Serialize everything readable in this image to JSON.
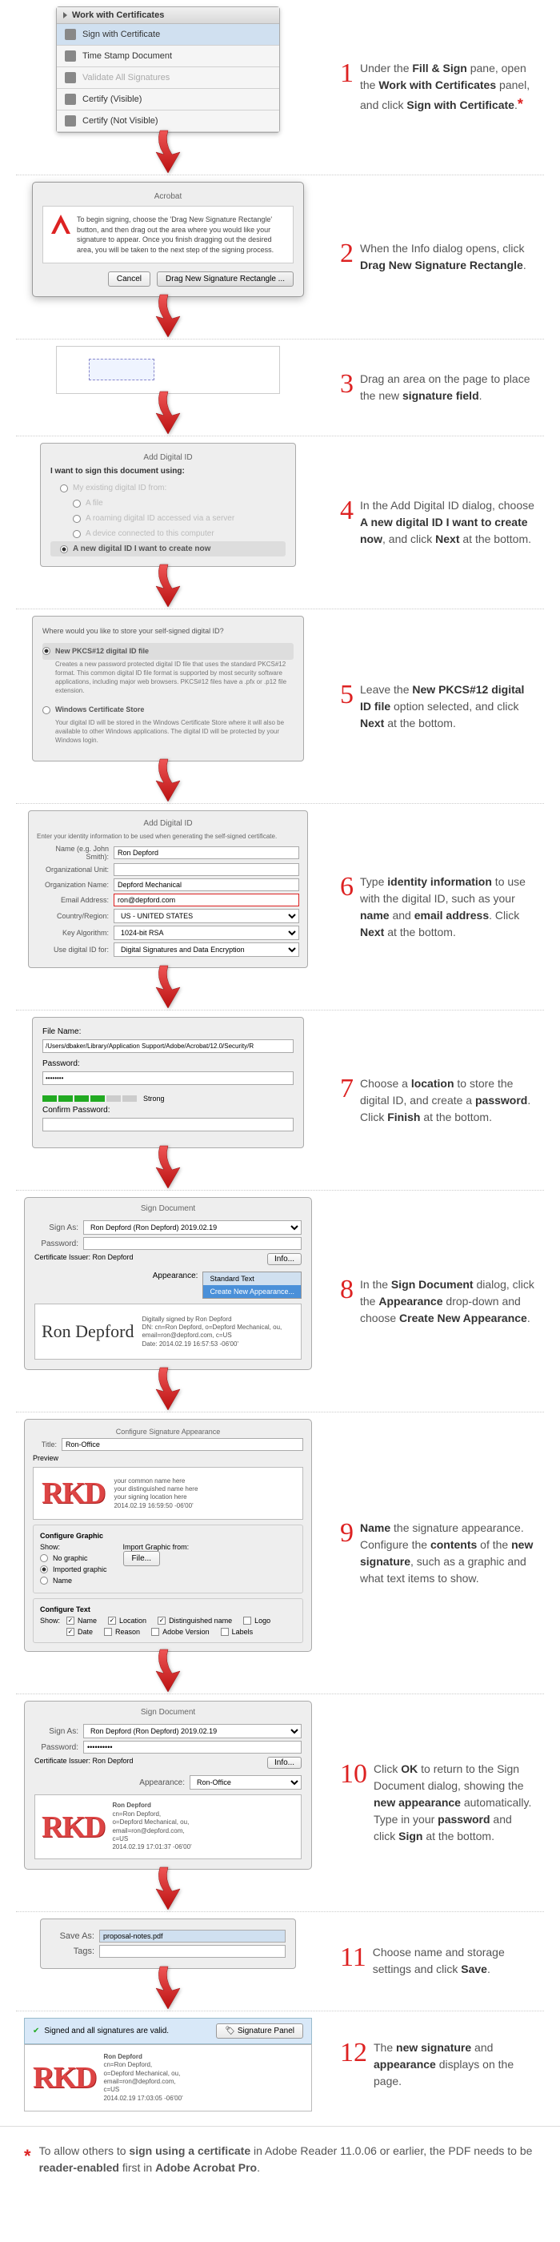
{
  "steps": {
    "s1": {
      "num": "1",
      "html": "Under the <b>Fill & Sign</b> pane, open the <b>Work with Certificates</b> panel, and click <b>Sign with Certificate</b>.<span class='asterisk'>*</span>"
    },
    "s2": {
      "num": "2",
      "html": "When the Info dialog opens, click <b>Drag New Signature Rectangle</b>."
    },
    "s3": {
      "num": "3",
      "html": "Drag an area on the page to place the new <b>signature field</b>."
    },
    "s4": {
      "num": "4",
      "html": "In the Add Digital ID dialog, choose <b>A new digital ID I want to create now</b>, and click <b>Next</b> at the bottom."
    },
    "s5": {
      "num": "5",
      "html": "Leave the <b>New PKCS#12 digital ID file</b> option selected, and click <b>Next</b> at the bottom."
    },
    "s6": {
      "num": "6",
      "html": "Type <b>identity information</b> to use with the digital ID, such as your <b>name</b> and <b>email address</b>. Click <b>Next</b> at the bottom."
    },
    "s7": {
      "num": "7",
      "html": "Choose a <b>location</b> to store the digital ID, and create a <b>password</b>. Click <b>Finish</b> at the bottom."
    },
    "s8": {
      "num": "8",
      "html": "In the <b>Sign Document</b> dialog, click the <b>Appearance</b> drop-down and choose <b>Create New Appearance</b>."
    },
    "s9": {
      "num": "9",
      "html": "<b>Name</b> the signature appearance. Configure the <b>contents</b> of the <b>new signature</b>, such as a graphic and what text items to show."
    },
    "s10": {
      "num": "10",
      "html": "Click <b>OK</b> to return to the Sign Document dialog, showing the <b>new appearance</b> automatically. Type in your <b>password</b> and click <b>Sign</b> at the bottom."
    },
    "s11": {
      "num": "11",
      "html": "Choose name and storage settings and click <b>Save</b>."
    },
    "s12": {
      "num": "12",
      "html": "The <b>new signature</b> and <b>appearance</b> displays on the page."
    }
  },
  "panel1": {
    "header": "Work with Certificates",
    "items": [
      "Sign with Certificate",
      "Time Stamp Document",
      "Validate All Signatures",
      "Certify (Visible)",
      "Certify (Not Visible)"
    ]
  },
  "dialog2": {
    "title": "Acrobat",
    "body": "To begin signing, choose the 'Drag New Signature Rectangle' button, and then drag out the area where you would like your signature to appear. Once you finish dragging out the desired area, you will be taken to the next step of the signing process.",
    "cancel": "Cancel",
    "drag": "Drag New Signature Rectangle ..."
  },
  "panel4": {
    "title": "Add Digital ID",
    "prompt": "I want to sign this document using:",
    "opts": [
      "My existing digital ID from:",
      "A file",
      "A roaming digital ID accessed via a server",
      "A device connected to this computer",
      "A new digital ID I want to create now"
    ]
  },
  "panel5": {
    "prompt": "Where would you like to store your self-signed digital ID?",
    "opt1_title": "New PKCS#12 digital ID file",
    "opt1_desc": "Creates a new password protected digital ID file that uses the standard PKCS#12 format. This common digital ID file format is supported by most security software applications, including major web browsers. PKCS#12 files have a .pfx or .p12 file extension.",
    "opt2_title": "Windows Certificate Store",
    "opt2_desc": "Your digital ID will be stored in the Windows Certificate Store where it will also be available to other Windows applications. The digital ID will be protected by your Windows login."
  },
  "panel6": {
    "title": "Add Digital ID",
    "prompt": "Enter your identity information to be used when generating the self-signed certificate.",
    "name_lbl": "Name (e.g. John Smith):",
    "name_val": "Ron Depford",
    "unit_lbl": "Organizational Unit:",
    "org_lbl": "Organization Name:",
    "org_val": "Depford Mechanical",
    "email_lbl": "Email Address:",
    "email_val": "ron@depford.com",
    "country_lbl": "Country/Region:",
    "country_val": "US - UNITED STATES",
    "key_lbl": "Key Algorithm:",
    "key_val": "1024-bit RSA",
    "use_lbl": "Use digital ID for:",
    "use_val": "Digital Signatures and Data Encryption"
  },
  "panel7": {
    "file_lbl": "File Name:",
    "file_val": "/Users/dbaker/Library/Application Support/Adobe/Acrobat/12.0/Security/R",
    "pass_lbl": "Password:",
    "strength": "Strong",
    "confirm_lbl": "Confirm Password:"
  },
  "panel8": {
    "title": "Sign Document",
    "signas_lbl": "Sign As:",
    "signas_val": "Ron Depford (Ron Depford) 2019.02.19",
    "pass_lbl": "Password:",
    "issuer_lbl": "Certificate Issuer: Ron Depford",
    "info": "Info...",
    "appear_lbl": "Appearance:",
    "dd_std": "Standard Text",
    "dd_new": "Create New Appearance...",
    "sig_name": "Ron Depford",
    "sig_details": "Digitally signed by Ron Depford\nDN: cn=Ron Depford, o=Depford Mechanical, ou,\nemail=ron@depford.com, c=US\nDate: 2014.02.19 16:57:53 -06'00'"
  },
  "panel9": {
    "title": "Configure Signature Appearance",
    "title_lbl": "Title:",
    "title_val": "Ron-Office",
    "preview_lbl": "Preview",
    "rkd": "RKD",
    "preview_lines": "your common name here\nyour distinguished name here\nyour signing location here\n2014.02.19 16:59:50 -06'00'",
    "graphic_title": "Configure Graphic",
    "show_lbl": "Show:",
    "g_none": "No graphic",
    "g_imported": "Imported graphic",
    "g_name": "Name",
    "import_lbl": "Import Graphic from:",
    "file_btn": "File...",
    "text_title": "Configure Text",
    "c_name": "Name",
    "c_loc": "Location",
    "c_dn": "Distinguished name",
    "c_logo": "Logo",
    "c_date": "Date",
    "c_reason": "Reason",
    "c_ver": "Adobe Version",
    "c_labels": "Labels"
  },
  "panel10": {
    "title": "Sign Document",
    "signas_lbl": "Sign As:",
    "signas_val": "Ron Depford (Ron Depford) 2019.02.19",
    "pass_lbl": "Password:",
    "pass_val": "••••••••••",
    "issuer_lbl": "Certificate Issuer: Ron Depford",
    "info": "Info...",
    "appear_lbl": "Appearance:",
    "appear_val": "Ron-Office",
    "rkd": "RKD",
    "sig_top": "Ron Depford",
    "sig_details": "cn=Ron Depford,\no=Depford Mechanical, ou,\nemail=ron@depford.com,\nc=US\n2014.02.19 17:01:37 -06'00'"
  },
  "panel11": {
    "save_lbl": "Save As:",
    "save_val": "proposal-notes.pdf",
    "tags_lbl": "Tags:"
  },
  "panel12": {
    "bar_text": "Signed and all signatures are valid.",
    "bar_btn": "Signature Panel",
    "rkd": "RKD",
    "sig_top": "Ron Depford",
    "sig_details": "cn=Ron Depford,\no=Depford Mechanical, ou,\nemail=ron@depford.com,\nc=US\n2014.02.19 17:03:05 -06'00'"
  },
  "footnote": "To allow others to <b>sign using a certificate</b> in Adobe Reader 11.0.06 or earlier, the PDF needs to be <b>reader-enabled</b> first in <b>Adobe Acrobat Pro</b>."
}
